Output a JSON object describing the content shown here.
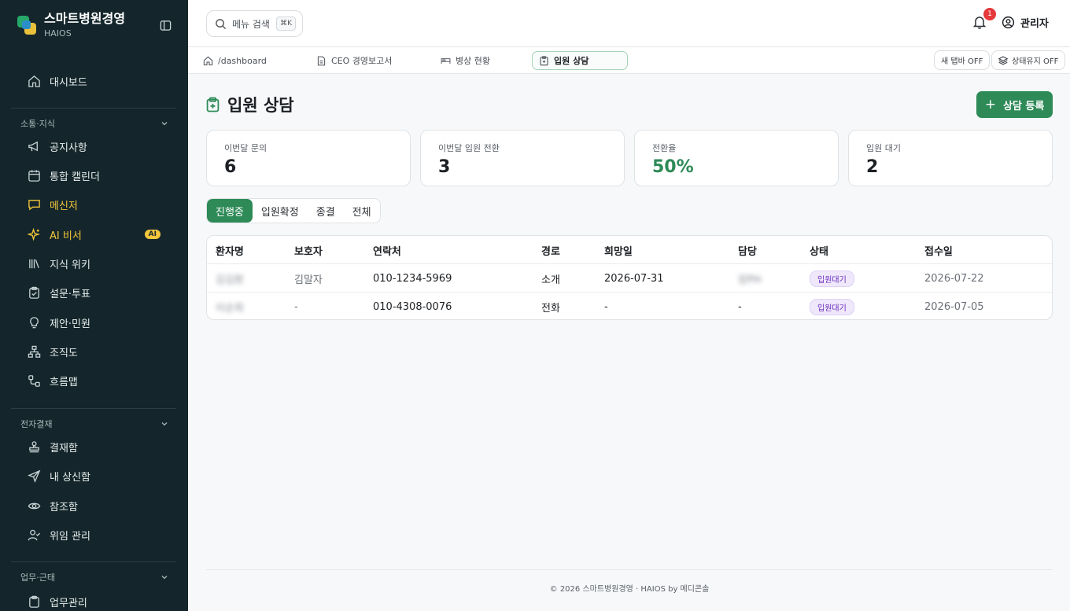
{
  "brand": {
    "title": "스마트병원경영",
    "subtitle": "HAIOS"
  },
  "sidebar": {
    "dashboard": "대시보드",
    "sections": [
      {
        "title": "소통·지식"
      },
      {
        "title": "전자결재"
      },
      {
        "title": "업무·근태"
      }
    ],
    "items": [
      {
        "label": "공지사항"
      },
      {
        "label": "통합 캘린더"
      },
      {
        "label": "메신저"
      },
      {
        "label": "AI 비서",
        "badge": "AI"
      },
      {
        "label": "지식 위키"
      },
      {
        "label": "설문·투표"
      },
      {
        "label": "제안·민원"
      },
      {
        "label": "조직도"
      },
      {
        "label": "흐름맵"
      },
      {
        "label": "결재함"
      },
      {
        "label": "내 상신함"
      },
      {
        "label": "참조함"
      },
      {
        "label": "위임 관리"
      },
      {
        "label": "업무관리"
      }
    ]
  },
  "header": {
    "search_placeholder": "메뉴 검색",
    "shortcut": "⌘K",
    "notification_count": "1",
    "user": "관리자"
  },
  "tabs": [
    {
      "label": "/dashboard"
    },
    {
      "label": "CEO 경영보고서"
    },
    {
      "label": "병상 현황"
    },
    {
      "label": "입원 상담"
    }
  ],
  "toggles": {
    "new_tab": "새 탭바 OFF",
    "keep_state": "상태유지 OFF"
  },
  "page": {
    "title": "입원 상담",
    "add_button": "상담 등록"
  },
  "stats": [
    {
      "label": "이번달 문의",
      "value": "6"
    },
    {
      "label": "이번달 입원 전환",
      "value": "3"
    },
    {
      "label": "전환율",
      "value": "50%"
    },
    {
      "label": "입원 대기",
      "value": "2"
    }
  ],
  "filters": [
    "진행중",
    "입원확정",
    "종결",
    "전체"
  ],
  "table": {
    "columns": [
      "환자명",
      "보호자",
      "연락처",
      "경로",
      "희망일",
      "담당",
      "상태",
      "접수일"
    ],
    "rows": [
      {
        "patient": "김김환",
        "guardian": "김말자",
        "phone": "010-1234-5969",
        "route": "소개",
        "desired": "2026-07-31",
        "owner": "장PH",
        "status": "입원대기",
        "received": "2026-07-22"
      },
      {
        "patient": "이순희",
        "guardian": "-",
        "phone": "010-4308-0076",
        "route": "전화",
        "desired": "-",
        "owner": "-",
        "status": "입원대기",
        "received": "2026-07-05"
      }
    ]
  },
  "footer": "© 2026 스마트병원경영 · HAIOS by 메디콘솔",
  "colors": {
    "sidebar_bg": "#14262b",
    "accent_green": "#2e8a57",
    "accent_yellow": "#f4c73b",
    "badge_purple": "#6a2bbd"
  }
}
